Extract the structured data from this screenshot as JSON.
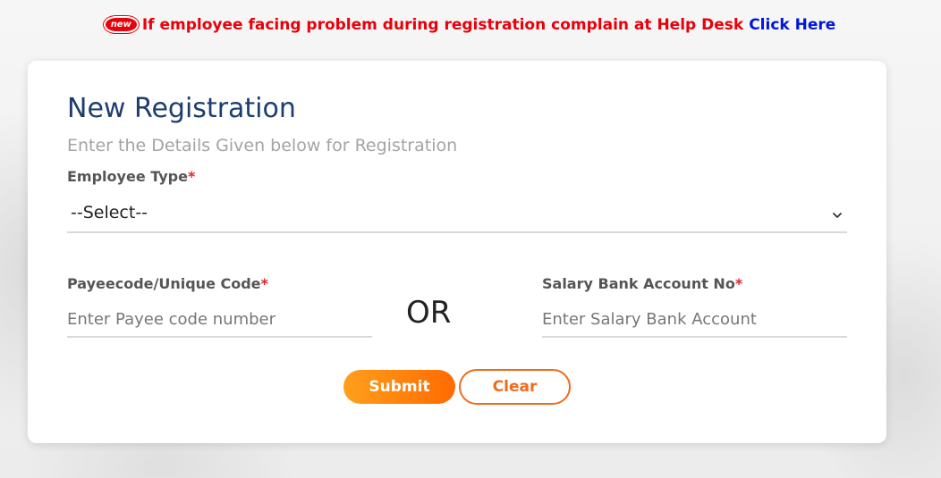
{
  "notice": {
    "badge": "new",
    "message": "If employee facing problem during registration complain at Help Desk",
    "link_text": "Click Here"
  },
  "form": {
    "title": "New Registration",
    "subtitle": "Enter the Details Given below for Registration",
    "employee_type": {
      "label": "Employee Type",
      "required_mark": "*",
      "selected": "--Select--"
    },
    "payee_code": {
      "label": "Payeecode/Unique Code",
      "required_mark": "*",
      "placeholder": "Enter Payee code number",
      "value": ""
    },
    "or_text": "OR",
    "bank_account": {
      "label": "Salary Bank Account No",
      "required_mark": "*",
      "placeholder": "Enter Salary Bank Account",
      "value": ""
    },
    "submit_label": "Submit",
    "clear_label": "Clear"
  },
  "colors": {
    "title": "#1d3d6e",
    "notice": "#e8000b",
    "link": "#0016d9",
    "accent": "#ff6a00"
  }
}
